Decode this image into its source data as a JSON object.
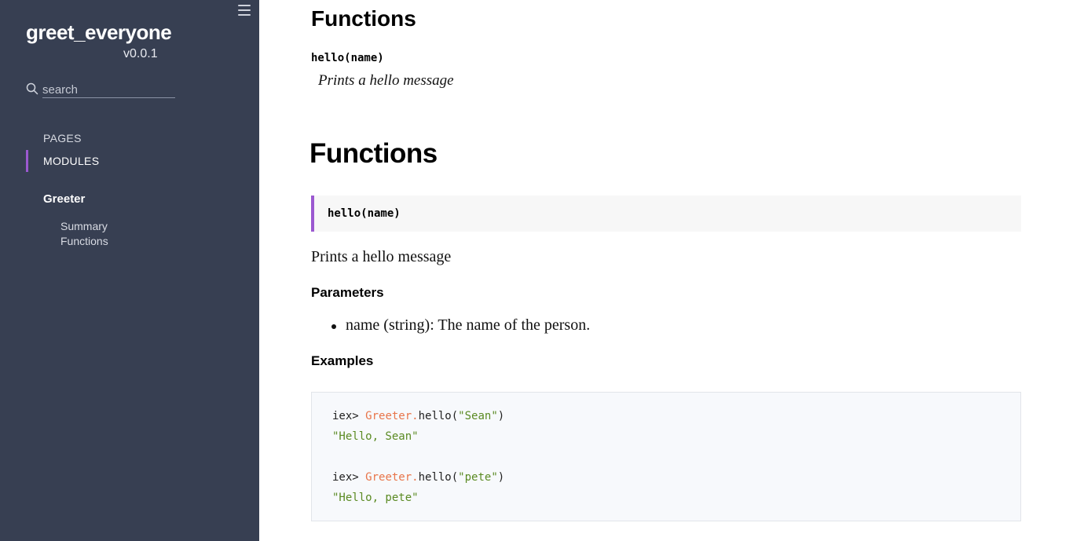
{
  "sidebar": {
    "project_name": "greet_everyone",
    "version": "v0.0.1",
    "search": {
      "placeholder": "search"
    },
    "nav_tabs": [
      {
        "label": "PAGES",
        "active": false
      },
      {
        "label": "MODULES",
        "active": true
      }
    ],
    "module": {
      "name": "Greeter",
      "links": [
        "Summary",
        "Functions"
      ]
    },
    "accent_color": "#9b59d0",
    "icons": {
      "menu": "hamburger-icon",
      "search": "search-icon"
    }
  },
  "summary": {
    "heading": "Functions",
    "signature": "hello(name)",
    "doc": "Prints a hello message"
  },
  "detail": {
    "heading": "Functions",
    "signature": "hello(name)",
    "doc": "Prints a hello message",
    "parameters_heading": "Parameters",
    "parameters": [
      "name (string): The name of the person."
    ],
    "examples_heading": "Examples",
    "code": {
      "line1_prompt": "iex> ",
      "line1_module": "Greeter.",
      "line1_call": "hello(",
      "line1_arg": "\"Sean\"",
      "line1_close": ")",
      "line2_result": "\"Hello, Sean\"",
      "line3_prompt": "iex> ",
      "line3_module": "Greeter.",
      "line3_call": "hello(",
      "line3_arg": "\"pete\"",
      "line3_close": ")",
      "line4_result": "\"Hello, pete\""
    }
  }
}
